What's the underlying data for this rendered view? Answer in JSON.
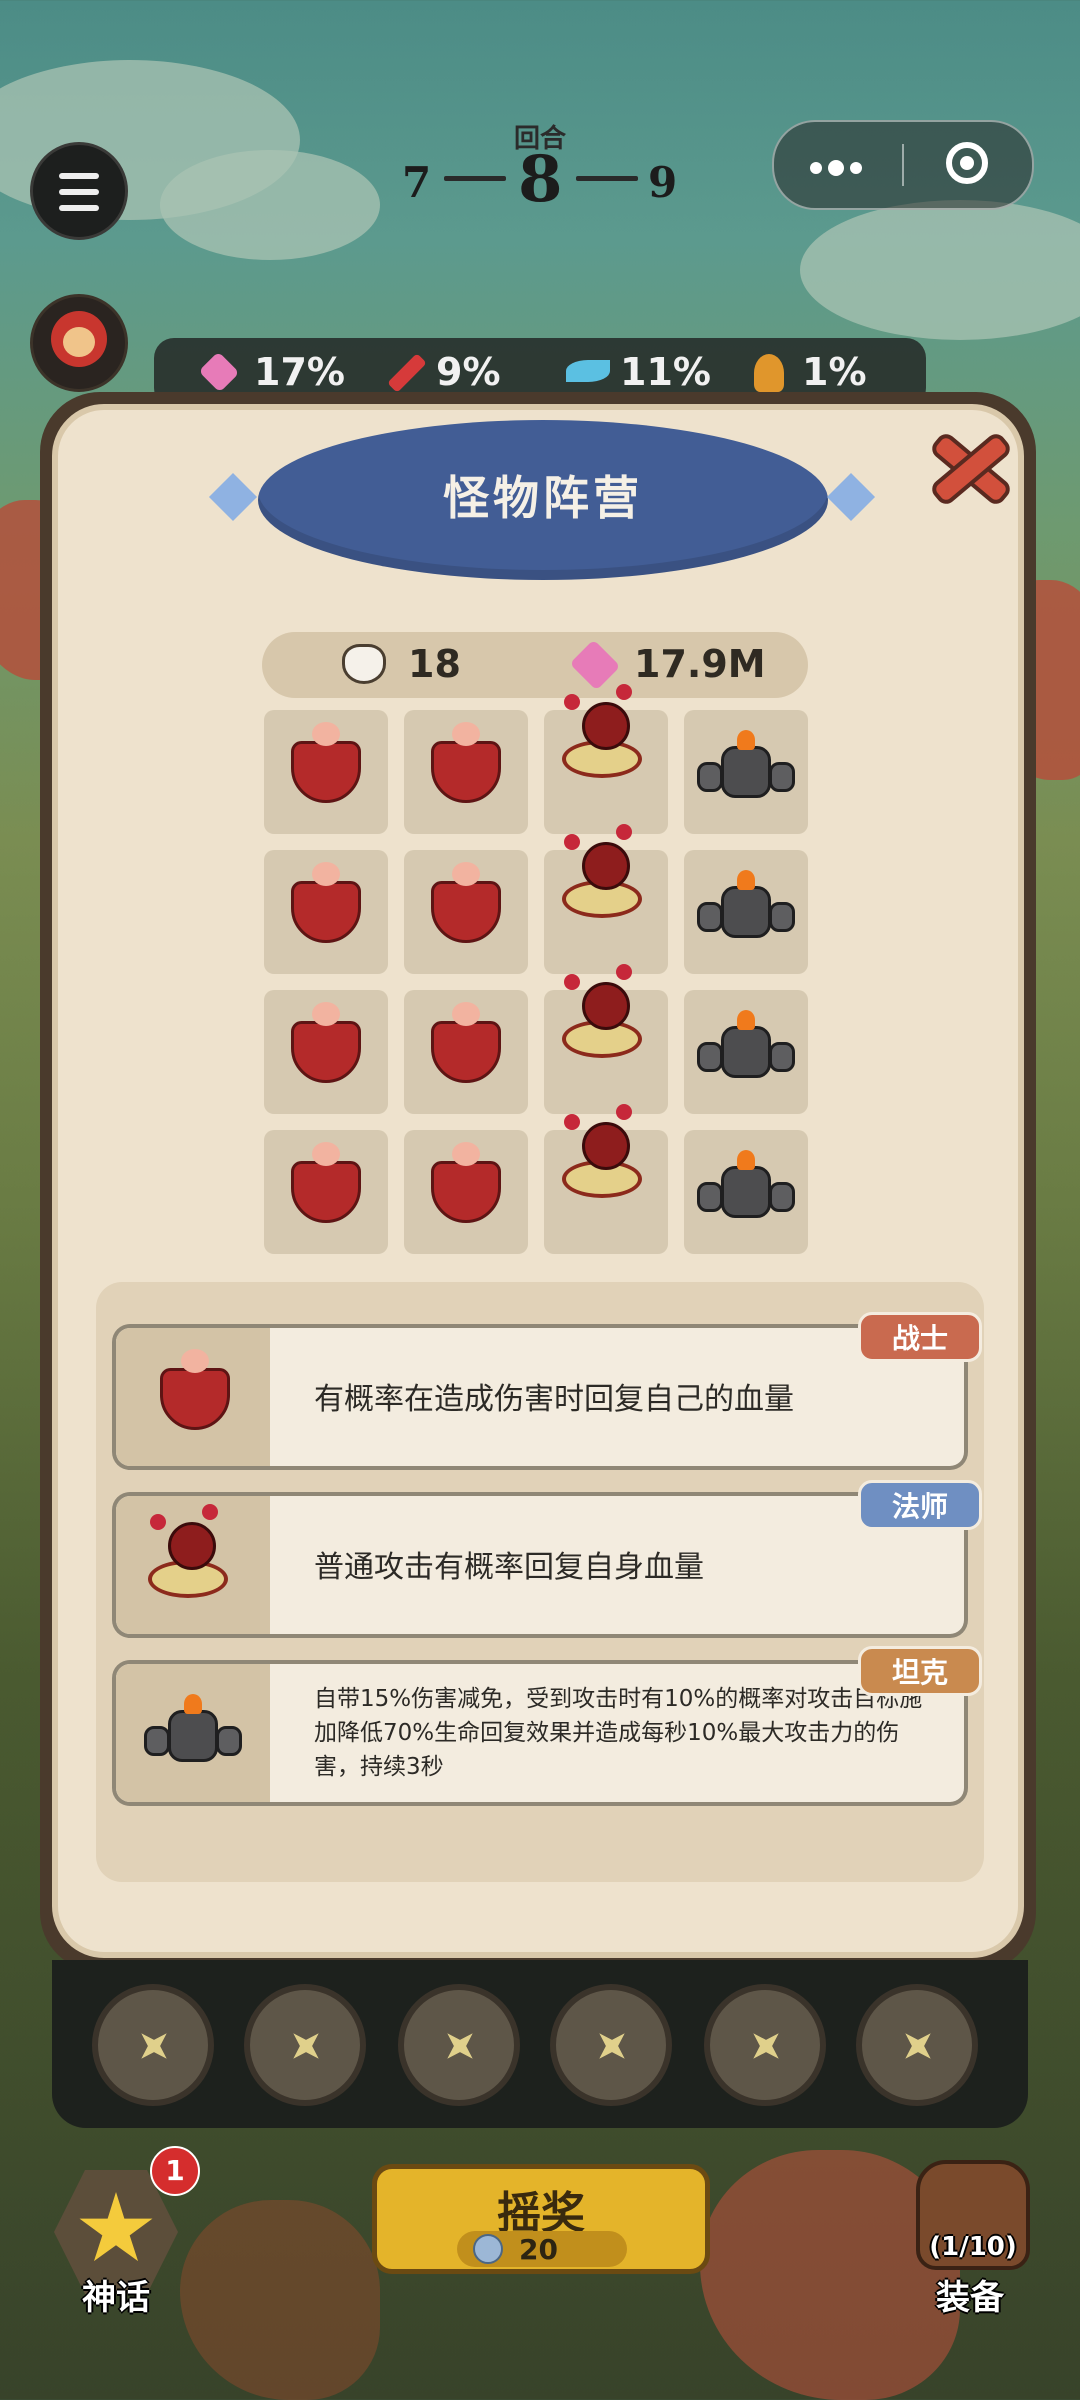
{
  "hud": {
    "round_label": "回合",
    "round_prev": "7",
    "round_current": "8",
    "round_next": "9"
  },
  "stats": [
    {
      "icon": "heart-icon",
      "value": "17%"
    },
    {
      "icon": "sword-icon",
      "value": "9%"
    },
    {
      "icon": "wing-icon",
      "value": "11%"
    },
    {
      "icon": "flame-icon",
      "value": "1%"
    }
  ],
  "panel": {
    "title": "怪物阵营",
    "monster_count": "18",
    "total_hp": "17.9M"
  },
  "grid": [
    [
      "warrior",
      "warrior",
      "mage",
      "tank"
    ],
    [
      "warrior",
      "warrior",
      "mage",
      "tank"
    ],
    [
      "warrior",
      "warrior",
      "mage",
      "tank"
    ],
    [
      "warrior",
      "warrior",
      "mage",
      "tank"
    ]
  ],
  "monster_types": [
    {
      "tag": "战士",
      "tag_color": "#c96a4f",
      "description": "有概率在造成伤害时回复自己的血量"
    },
    {
      "tag": "法师",
      "tag_color": "#6f8fc2",
      "description": "普通攻击有概率回复自身血量"
    },
    {
      "tag": "坦克",
      "tag_color": "#c98a4f",
      "description": "自带15%伤害减免，受到攻击时有10%的概率对攻击目标施加降低70%生命回复效果并造成每秒10%最大攻击力的伤害，持续3秒"
    }
  ],
  "bottom": {
    "myth_label": "神话",
    "myth_badge": "1",
    "spin_label": "摇奖",
    "spin_cost": "20",
    "equip_label": "装备",
    "equip_count": "(1/10)"
  }
}
